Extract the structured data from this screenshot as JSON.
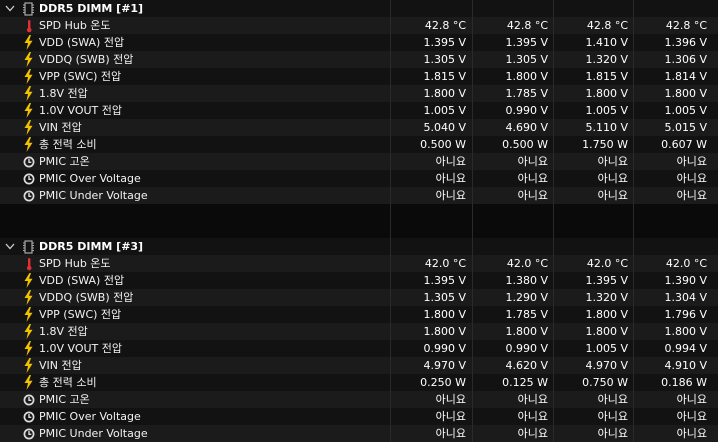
{
  "sections": [
    {
      "title": "DDR5 DIMM [#1]",
      "rows": [
        {
          "icon": "thermometer-icon",
          "label": "SPD Hub 온도",
          "values": [
            "42.8 °C",
            "42.8 °C",
            "42.8 °C",
            "42.8 °C"
          ]
        },
        {
          "icon": "lightning-icon",
          "label": "VDD (SWA) 전압",
          "values": [
            "1.395 V",
            "1.395 V",
            "1.410 V",
            "1.396 V"
          ]
        },
        {
          "icon": "lightning-icon",
          "label": "VDDQ (SWB) 전압",
          "values": [
            "1.305 V",
            "1.305 V",
            "1.320 V",
            "1.306 V"
          ]
        },
        {
          "icon": "lightning-icon",
          "label": "VPP (SWC) 전압",
          "values": [
            "1.815 V",
            "1.800 V",
            "1.815 V",
            "1.814 V"
          ]
        },
        {
          "icon": "lightning-icon",
          "label": "1.8V 전압",
          "values": [
            "1.800 V",
            "1.785 V",
            "1.800 V",
            "1.800 V"
          ]
        },
        {
          "icon": "lightning-icon",
          "label": "1.0V VOUT 전압",
          "values": [
            "1.005 V",
            "0.990 V",
            "1.005 V",
            "1.005 V"
          ]
        },
        {
          "icon": "lightning-icon",
          "label": "VIN 전압",
          "values": [
            "5.040 V",
            "4.690 V",
            "5.110 V",
            "5.015 V"
          ]
        },
        {
          "icon": "lightning-icon",
          "label": "총 전력 소비",
          "values": [
            "0.500 W",
            "0.500 W",
            "1.750 W",
            "0.607 W"
          ]
        },
        {
          "icon": "clock-icon",
          "label": "PMIC 고온",
          "values": [
            "아니요",
            "아니요",
            "아니요",
            "아니요"
          ]
        },
        {
          "icon": "clock-icon",
          "label": "PMIC Over Voltage",
          "values": [
            "아니요",
            "아니요",
            "아니요",
            "아니요"
          ]
        },
        {
          "icon": "clock-icon",
          "label": "PMIC Under Voltage",
          "values": [
            "아니요",
            "아니요",
            "아니요",
            "아니요"
          ]
        }
      ]
    },
    {
      "title": "DDR5 DIMM [#3]",
      "rows": [
        {
          "icon": "thermometer-icon",
          "label": "SPD Hub 온도",
          "values": [
            "42.0 °C",
            "42.0 °C",
            "42.0 °C",
            "42.0 °C"
          ]
        },
        {
          "icon": "lightning-icon",
          "label": "VDD (SWA) 전압",
          "values": [
            "1.395 V",
            "1.380 V",
            "1.395 V",
            "1.390 V"
          ]
        },
        {
          "icon": "lightning-icon",
          "label": "VDDQ (SWB) 전압",
          "values": [
            "1.305 V",
            "1.290 V",
            "1.320 V",
            "1.304 V"
          ]
        },
        {
          "icon": "lightning-icon",
          "label": "VPP (SWC) 전압",
          "values": [
            "1.800 V",
            "1.785 V",
            "1.800 V",
            "1.796 V"
          ]
        },
        {
          "icon": "lightning-icon",
          "label": "1.8V 전압",
          "values": [
            "1.800 V",
            "1.800 V",
            "1.800 V",
            "1.800 V"
          ]
        },
        {
          "icon": "lightning-icon",
          "label": "1.0V VOUT 전압",
          "values": [
            "0.990 V",
            "0.990 V",
            "1.005 V",
            "0.994 V"
          ]
        },
        {
          "icon": "lightning-icon",
          "label": "VIN 전압",
          "values": [
            "4.970 V",
            "4.620 V",
            "4.970 V",
            "4.910 V"
          ]
        },
        {
          "icon": "lightning-icon",
          "label": "총 전력 소비",
          "values": [
            "0.250 W",
            "0.125 W",
            "0.750 W",
            "0.186 W"
          ]
        },
        {
          "icon": "clock-icon",
          "label": "PMIC 고온",
          "values": [
            "아니요",
            "아니요",
            "아니요",
            "아니요"
          ]
        },
        {
          "icon": "clock-icon",
          "label": "PMIC Over Voltage",
          "values": [
            "아니요",
            "아니요",
            "아니요",
            "아니요"
          ]
        },
        {
          "icon": "clock-icon",
          "label": "PMIC Under Voltage",
          "values": [
            "아니요",
            "아니요",
            "아니요",
            "아니요"
          ]
        }
      ]
    }
  ],
  "colors": {
    "thermometer": "#e03030",
    "lightning": "#f2c200",
    "clock": "#dcdcdc",
    "chip": "#a9a9a9"
  }
}
